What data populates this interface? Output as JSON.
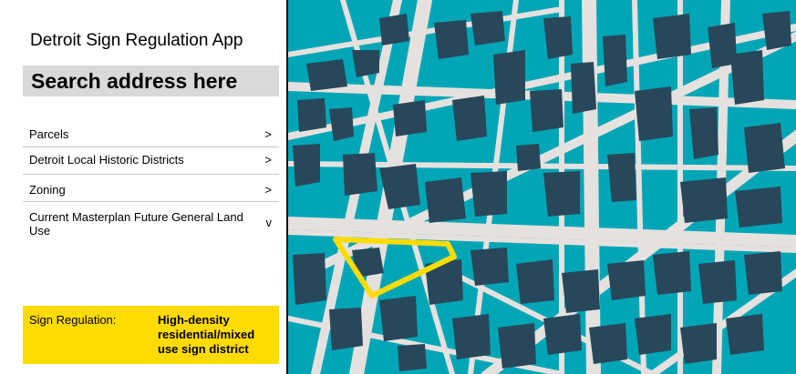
{
  "app": {
    "title": "Detroit Sign Regulation App"
  },
  "search": {
    "placeholder": "Search address here"
  },
  "layers": [
    {
      "label": "Parcels",
      "chevron": ">"
    },
    {
      "label": "Detroit Local Historic Districts",
      "chevron": ">"
    },
    {
      "label": "Zoning",
      "chevron": ">"
    },
    {
      "label": "Current Masterplan Future General Land Use",
      "chevron": "v"
    }
  ],
  "sign_regulation": {
    "label": "Sign Regulation:",
    "value": "High-density residential/mixed use sign district"
  },
  "map": {
    "colors": {
      "ground": "#00a6b6",
      "street": "#e5e1df",
      "building": "#29475a",
      "highlight": "#ffdc00"
    }
  }
}
